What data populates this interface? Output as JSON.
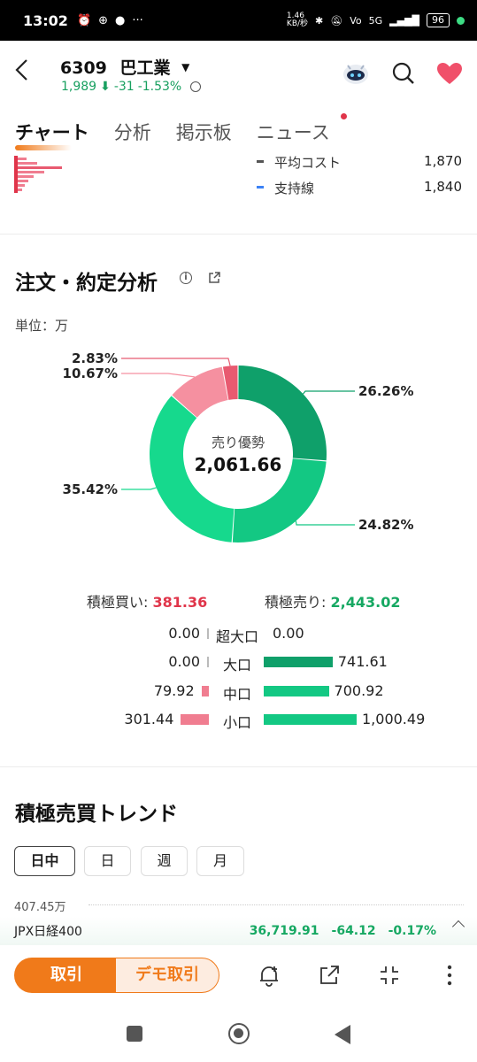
{
  "status_bar": {
    "time": "13:02",
    "net_speed": "1.46\nKB/秒",
    "battery": "96",
    "network": "5G"
  },
  "header": {
    "code": "6309",
    "name": "巴工業",
    "price": "1,989",
    "change": "-31",
    "change_pct": "-1.53%"
  },
  "tabs": [
    {
      "label": "チャート",
      "active": true
    },
    {
      "label": "分析"
    },
    {
      "label": "掲示板"
    },
    {
      "label": "ニュース",
      "badge": true
    }
  ],
  "chart_legend": [
    {
      "label": "平均コスト",
      "value": "1,870",
      "color": "#555555"
    },
    {
      "label": "支持線",
      "value": "1,840",
      "color": "#3b82f6"
    }
  ],
  "order_analysis": {
    "title": "注文・約定分析",
    "unit": "単位：万",
    "center_label": "売り優勢",
    "center_value": "2,061.66",
    "buy_label": "積極買い:",
    "buy_value": "381.36",
    "sell_label": "積極売り:",
    "sell_value": "2,443.02"
  },
  "chart_data": {
    "type": "pie",
    "title": "",
    "center_label": "売り優勢",
    "center_value": "2,061.66",
    "slices": [
      {
        "label": "26.26%",
        "value": 26.26,
        "color": "#0fa06a"
      },
      {
        "label": "24.82%",
        "value": 24.82,
        "color": "#13c883"
      },
      {
        "label": "35.42%",
        "value": 35.42,
        "color": "#16d98d"
      },
      {
        "label": "10.67%",
        "value": 10.67,
        "color": "#f590a0"
      },
      {
        "label": "2.83%",
        "value": 2.83,
        "color": "#e85a70"
      }
    ]
  },
  "breakdown": [
    {
      "category": "超大口",
      "buy": "0.00",
      "sell": "0.00",
      "buy_num": 0,
      "sell_num": 0
    },
    {
      "category": "大口",
      "buy": "0.00",
      "sell": "741.61",
      "buy_num": 0,
      "sell_num": 741.61
    },
    {
      "category": "中口",
      "buy": "79.92",
      "sell": "700.92",
      "buy_num": 79.92,
      "sell_num": 700.92
    },
    {
      "category": "小口",
      "buy": "301.44",
      "sell": "1,000.49",
      "buy_num": 301.44,
      "sell_num": 1000.49
    }
  ],
  "trend": {
    "title": "積極売買トレンド",
    "periods": [
      "日中",
      "日",
      "週",
      "月"
    ],
    "active_period": "日中",
    "axis_top": "407.45万"
  },
  "index_ticker": {
    "name": "JPX日経400",
    "value": "36,719.91",
    "change": "-64.12",
    "change_pct": "-0.17%"
  },
  "bottom_bar": {
    "trade_label": "取引",
    "demo_label": "デモ取引"
  }
}
